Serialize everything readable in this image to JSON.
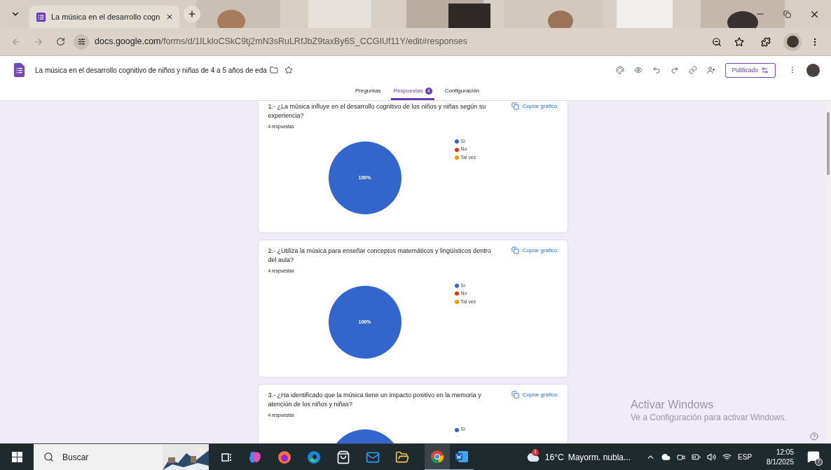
{
  "browser": {
    "tab": {
      "title": "La música en el desarrollo cogn"
    },
    "url": {
      "domain": "docs.google.com",
      "path": "/forms/d/1ILkloCSkC9tj2mN3sRuLRfJbZ9taxBy6S_CCGIUf11Y/edit#responses"
    }
  },
  "form": {
    "title": "La música en el desarrollo cognitivo de niños y niñas de 4 a 5 años de eda",
    "publish_button": "Publicado"
  },
  "tabs": [
    {
      "label": "Preguntas",
      "selected": false
    },
    {
      "label": "Respuestas",
      "selected": true,
      "badge": "4"
    },
    {
      "label": "Configuración",
      "selected": false
    }
  ],
  "questions": [
    {
      "title": "1.- ¿La música influye en el desarrollo cognitivo de los niños y niñas según su experiencia?",
      "count": "4 respuestas",
      "copy_button": "Copiar gráfico",
      "chart_data": {
        "type": "pie",
        "categories": [
          "Sí",
          "No",
          "Tal vez"
        ],
        "colors": [
          "#3366cc",
          "#dc3912",
          "#ff9900"
        ],
        "values": [
          100,
          0,
          0
        ],
        "value_labels": [
          "100%",
          null,
          null
        ]
      }
    },
    {
      "title": "2.- ¿Utiliza la música para enseñar conceptos matemáticos y lingüísticos dentro del aula?",
      "count": "4 respuestas",
      "copy_button": "Copiar gráfico",
      "chart_data": {
        "type": "pie",
        "categories": [
          "Sí",
          "No",
          "Tal vez"
        ],
        "colors": [
          "#3366cc",
          "#dc3912",
          "#ff9900"
        ],
        "values": [
          100,
          0,
          0
        ],
        "value_labels": [
          "100%",
          null,
          null
        ]
      }
    },
    {
      "title": "3.- ¿Ha identificado que la música tiene un impacto positivo en la memoria y atención de los niños y niñas?",
      "count": "4 respuestas",
      "copy_button": "Copiar gráfico",
      "chart_data": {
        "type": "pie",
        "categories": [
          "Sí"
        ],
        "colors": [
          "#3366cc"
        ]
      }
    }
  ],
  "watermark": {
    "title": "Activar Windows",
    "subtitle": "Ve a Configuración para activar Windows."
  },
  "taskbar": {
    "search": "Buscar",
    "weather": {
      "badge": "1",
      "temperature": "16°C",
      "condition": "Mayorm. nubla..."
    },
    "language": "ESP",
    "time": "12:05",
    "date": "8/1/2025",
    "notifications": "7"
  }
}
